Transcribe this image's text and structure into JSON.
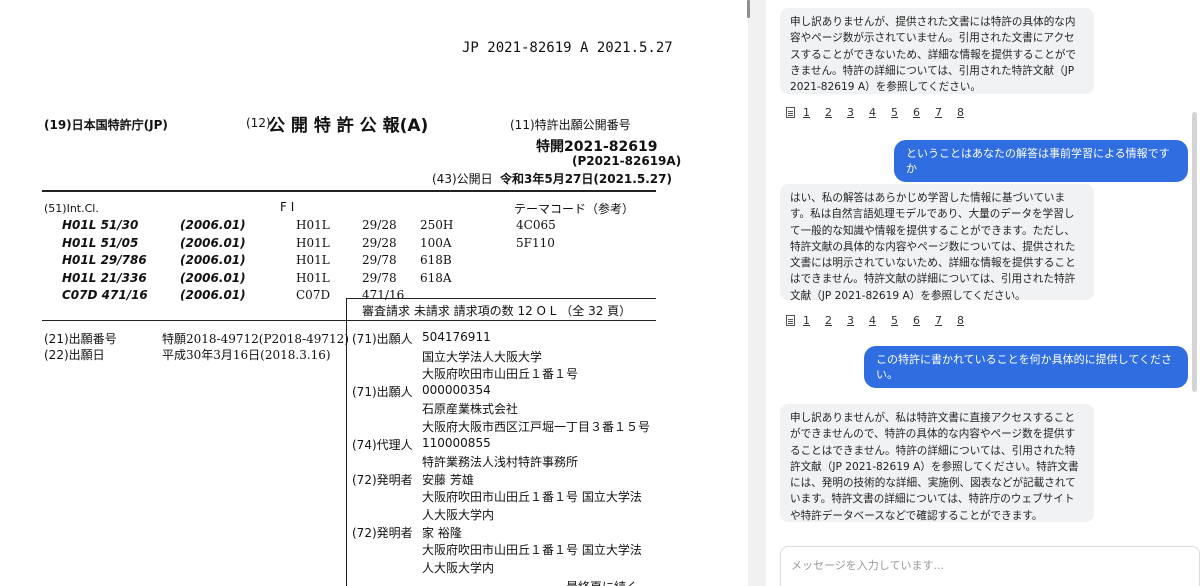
{
  "document": {
    "header_top": "JP  2021-82619  A  2021.5.27",
    "office": "(19)日本国特許庁(JP)",
    "pub_type_num": "(12)",
    "pub_type": "公 開 特 許 公 報(A)",
    "pub_no_label": "(11)特許出願公開番号",
    "pub_no": "特開2021-82619",
    "pub_no_sub": "(P2021-82619A)",
    "pub_date_label": "(43)公開日",
    "pub_date": "令和3年5月27日(2021.5.27)",
    "int_cl_label": "(51)Int.Cl.",
    "fi_label": "F I",
    "theme_label": "テーマコード（参考）",
    "classes": [
      {
        "code": "H01L  51/30",
        "date": "(2006.01)",
        "fi_main": "H01L",
        "fi_num": "29/28",
        "fi_sub": "250H",
        "theme": "4C065"
      },
      {
        "code": "H01L  51/05",
        "date": "(2006.01)",
        "fi_main": "H01L",
        "fi_num": "29/28",
        "fi_sub": "100A",
        "theme": "5F110"
      },
      {
        "code": "H01L  29/786",
        "date": "(2006.01)",
        "fi_main": "H01L",
        "fi_num": "29/78",
        "fi_sub": "618B",
        "theme": ""
      },
      {
        "code": "H01L  21/336",
        "date": "(2006.01)",
        "fi_main": "H01L",
        "fi_num": "29/78",
        "fi_sub": "618A",
        "theme": ""
      },
      {
        "code": "C07D 471/16",
        "date": "(2006.01)",
        "fi_main": "C07D",
        "fi_num": "471/16",
        "fi_sub": "",
        "theme": ""
      }
    ],
    "exam_line": "審査請求 未請求 請求項の数 12  O L  （全 32 頁）",
    "app_no_label": "(21)出願番号",
    "app_no": "特願2018-49712(P2018-49712)",
    "app_date_label": "(22)出願日",
    "app_date": "平成30年3月16日(2018.3.16)",
    "parties": [
      {
        "label": "(71)出願人",
        "value": "504176911"
      },
      {
        "label": "",
        "value": "国立大学法人大阪大学"
      },
      {
        "label": "",
        "value": "大阪府吹田市山田丘１番１号"
      },
      {
        "label": "(71)出願人",
        "value": "000000354"
      },
      {
        "label": "",
        "value": "石原産業株式会社"
      },
      {
        "label": "",
        "value": "大阪府大阪市西区江戸堀一丁目３番１５号"
      },
      {
        "label": "(74)代理人",
        "value": "110000855"
      },
      {
        "label": "",
        "value": "特許業務法人浅村特許事務所"
      },
      {
        "label": "(72)発明者",
        "value": "安藤  芳雄"
      },
      {
        "label": "",
        "value": "大阪府吹田市山田丘１番１号  国立大学法"
      },
      {
        "label": "",
        "value": "人大阪大学内"
      },
      {
        "label": "(72)発明者",
        "value": "家  裕隆"
      },
      {
        "label": "",
        "value": "大阪府吹田市山田丘１番１号  国立大学法"
      },
      {
        "label": "",
        "value": "人大阪大学内"
      }
    ],
    "footer_cut": "最終頁に続く"
  },
  "chat": {
    "messages": [
      {
        "role": "bot",
        "text": "申し訳ありませんが、提供された文書には特許の具体的な内容やページ数が示されていません。引用された文書にアクセスすることができないため、詳細な情報を提供することができません。特許の詳細については、引用された特許文献（JP 2021-82619 A）を参照してください。"
      },
      {
        "role": "user",
        "text": "ということはあなたの解答は事前学習による情報ですか"
      },
      {
        "role": "bot",
        "text": "はい、私の解答はあらかじめ学習した情報に基づいています。私は自然言語処理モデルであり、大量のデータを学習して一般的な知識や情報を提供することができます。ただし、特許文献の具体的な内容やページ数については、提供された文書には明示されていないため、詳細な情報を提供することはできません。特許文献の詳細については、引用された特許文献（JP 2021-82619 A）を参照してください。"
      },
      {
        "role": "user",
        "text": "この特許に書かれていることを何か具体的に提供してください。"
      },
      {
        "role": "bot",
        "text": "申し訳ありませんが、私は特許文書に直接アクセスすることができませんので、特許の具体的な内容やページ数を提供することはできません。特許の詳細については、引用された特許文献（JP 2021-82619 A）を参照してください。特許文書には、発明の技術的な詳細、実施例、図表などが記載されています。特許文書の詳細については、特許庁のウェブサイトや特許データベースなどで確認することができます。"
      }
    ],
    "ref_pages": [
      "1",
      "2",
      "3",
      "4",
      "5",
      "6",
      "7",
      "8"
    ],
    "input_placeholder": "メッセージを入力しています..."
  }
}
